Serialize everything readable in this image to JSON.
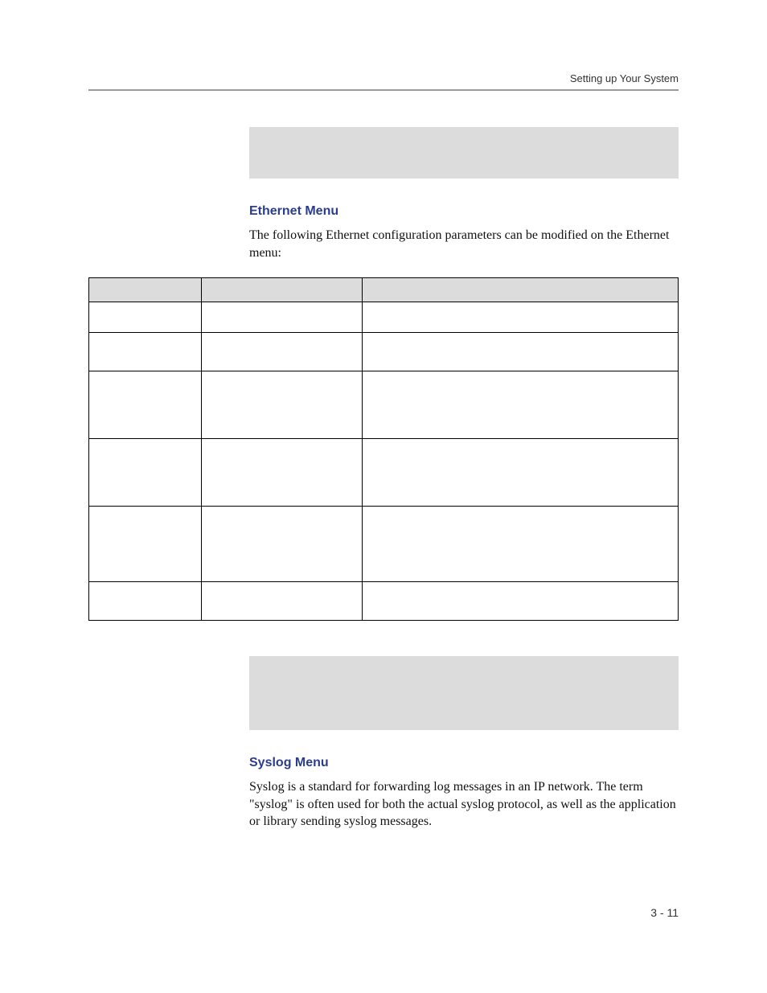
{
  "header": {
    "section_title": "Setting up Your System"
  },
  "sections": {
    "ethernet": {
      "heading": "Ethernet Menu",
      "intro": "The following Ethernet configuration parameters can be modified on the Ethernet menu:"
    },
    "syslog": {
      "heading": "Syslog Menu",
      "intro": "Syslog is a standard for forwarding log messages in an IP network. The term \"syslog\" is often used for both the actual syslog protocol, as well as the application or library sending syslog messages."
    }
  },
  "page_number": "3 - 11"
}
